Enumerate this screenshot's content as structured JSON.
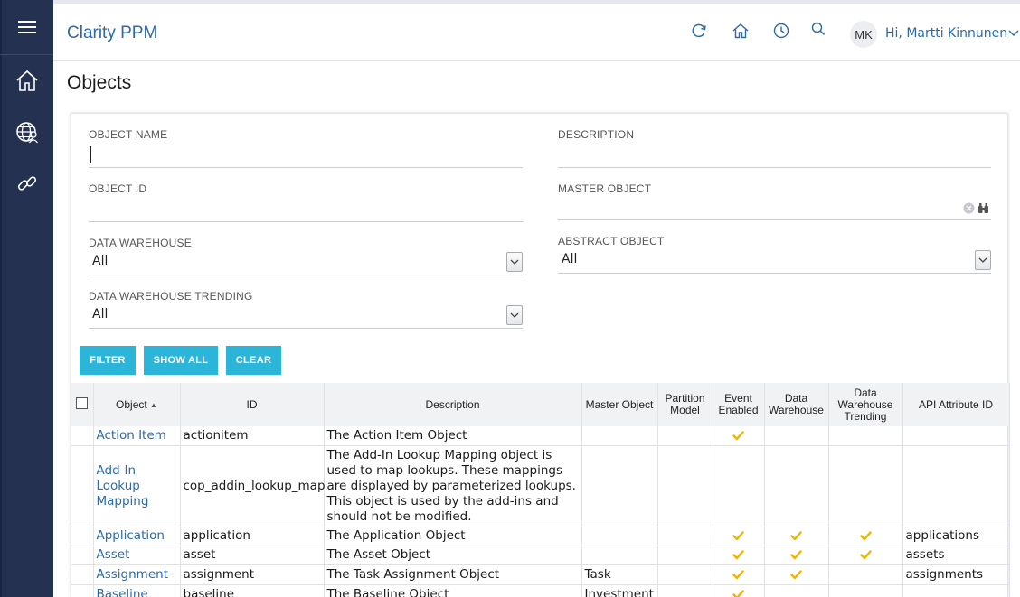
{
  "app": {
    "title": "Clarity PPM"
  },
  "user": {
    "initials": "MK",
    "greeting": "Hi, Martti Kinnunen"
  },
  "page": {
    "title": "Objects"
  },
  "filters": {
    "object_name": {
      "label": "OBJECT NAME",
      "value": ""
    },
    "description": {
      "label": "DESCRIPTION",
      "value": ""
    },
    "object_id": {
      "label": "OBJECT ID",
      "value": ""
    },
    "master_object": {
      "label": "MASTER OBJECT",
      "value": ""
    },
    "data_warehouse": {
      "label": "DATA WAREHOUSE",
      "value": "All"
    },
    "abstract_object": {
      "label": "ABSTRACT OBJECT",
      "value": "All"
    },
    "data_warehouse_trending": {
      "label": "DATA WAREHOUSE TRENDING",
      "value": "All"
    }
  },
  "buttons": {
    "filter": "FILTER",
    "show_all": "SHOW ALL",
    "clear": "CLEAR"
  },
  "table": {
    "columns": [
      "Object",
      "ID",
      "Description",
      "Master Object",
      "Partition Model",
      "Event Enabled",
      "Data Warehouse",
      "Data Warehouse Trending",
      "API Attribute ID"
    ],
    "rows": [
      {
        "object": "Action Item",
        "id": "actionitem",
        "description": "The Action Item Object",
        "master": "",
        "partition": "",
        "event": true,
        "dw": false,
        "dwt": false,
        "api": ""
      },
      {
        "object": "Add-In Lookup Mapping",
        "id": "cop_addin_lookup_map",
        "description": "The Add-In Lookup Mapping object is used to map lookups. These mappings are displayed by parameterized lookups. This object is used by the add-ins and should not be modified.",
        "master": "",
        "partition": "",
        "event": false,
        "dw": false,
        "dwt": false,
        "api": ""
      },
      {
        "object": "Application",
        "id": "application",
        "description": "The Application Object",
        "master": "",
        "partition": "",
        "event": true,
        "dw": true,
        "dwt": true,
        "api": "applications"
      },
      {
        "object": "Asset",
        "id": "asset",
        "description": "The Asset Object",
        "master": "",
        "partition": "",
        "event": true,
        "dw": true,
        "dwt": true,
        "api": "assets"
      },
      {
        "object": "Assignment",
        "id": "assignment",
        "description": "The Task Assignment Object",
        "master": "Task",
        "partition": "",
        "event": true,
        "dw": true,
        "dwt": false,
        "api": "assignments"
      },
      {
        "object": "Baseline",
        "id": "baseline",
        "description": "The Baseline Object",
        "master": "Investment",
        "partition": "",
        "event": true,
        "dw": false,
        "dwt": false,
        "api": ""
      }
    ]
  },
  "colors": {
    "rail": "#243150",
    "accent": "#2c6aa8",
    "button": "#2bb5d8",
    "check": "#f0b400"
  },
  "icons": {
    "menu": "hamburger-icon",
    "home": "home-icon",
    "globe": "globe-person-icon",
    "link": "link-icon",
    "refresh": "refresh-icon",
    "history": "clock-icon",
    "search": "search-icon",
    "chevron": "chevron-down-icon",
    "clear": "clear-circle-icon",
    "lookup": "binoculars-icon",
    "check": "checkmark-icon"
  }
}
